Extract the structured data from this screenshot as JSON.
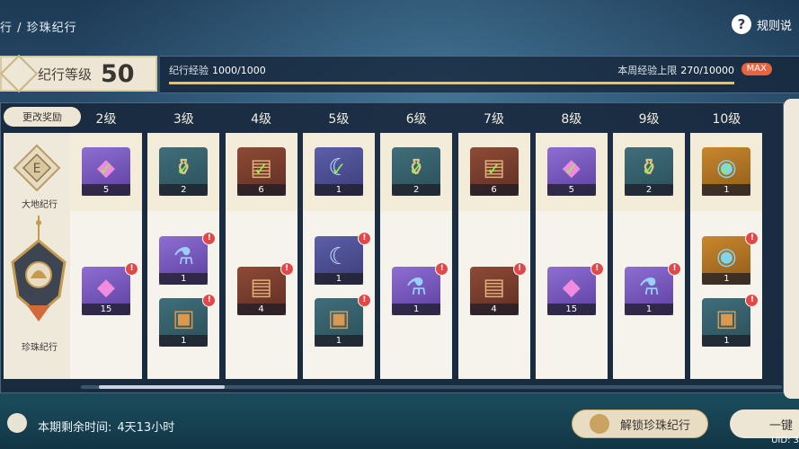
{
  "breadcrumb": "行 / 珍珠纪行",
  "help_label": "规则说",
  "level": {
    "label": "纪行等级",
    "value": "50"
  },
  "exp": {
    "label": "纪行经验",
    "value": "1000/1000",
    "progress": 1.0
  },
  "weekly": {
    "label": "本周经验上限",
    "value": "270/10000",
    "badge": "MAX"
  },
  "change_reward": "更改奖励",
  "tracks": [
    {
      "name": "大地纪行"
    },
    {
      "name": "珍珠纪行"
    }
  ],
  "columns": [
    {
      "level": "2级",
      "free": {
        "icon": "crystal",
        "count": "5"
      },
      "paid": [
        {
          "icon": "crystal",
          "count": "15"
        }
      ]
    },
    {
      "level": "3级",
      "free": {
        "icon": "bottle",
        "count": "2"
      },
      "paid": [
        {
          "icon": "potion",
          "count": "1"
        },
        {
          "icon": "chest",
          "count": "1"
        }
      ]
    },
    {
      "level": "4级",
      "free": {
        "icon": "book",
        "count": "6"
      },
      "paid": [
        {
          "icon": "book",
          "count": "4"
        }
      ]
    },
    {
      "level": "5级",
      "free": {
        "icon": "moon",
        "count": "1"
      },
      "paid": [
        {
          "icon": "moon",
          "count": "1"
        },
        {
          "icon": "chest",
          "count": "1"
        }
      ]
    },
    {
      "level": "6级",
      "free": {
        "icon": "bottle",
        "count": "2"
      },
      "paid": [
        {
          "icon": "potion",
          "count": "1"
        }
      ]
    },
    {
      "level": "7级",
      "free": {
        "icon": "book",
        "count": "6"
      },
      "paid": [
        {
          "icon": "book",
          "count": "4"
        }
      ]
    },
    {
      "level": "8级",
      "free": {
        "icon": "crystal",
        "count": "5"
      },
      "paid": [
        {
          "icon": "crystal",
          "count": "15"
        }
      ]
    },
    {
      "level": "9级",
      "free": {
        "icon": "bottle",
        "count": "2"
      },
      "paid": [
        {
          "icon": "potion",
          "count": "1"
        }
      ]
    },
    {
      "level": "10级",
      "free": {
        "icon": "orb",
        "count": "1"
      },
      "paid": [
        {
          "icon": "orb",
          "count": "1"
        },
        {
          "icon": "chest",
          "count": "1"
        }
      ]
    }
  ],
  "remaining": {
    "label": "本期剩余时间:",
    "value": "4天13小时"
  },
  "unlock_label": "解锁珍珠纪行",
  "onekey_label": "一键",
  "uid": "UID: 3",
  "badge_mark": "!",
  "check_mark": "✓"
}
